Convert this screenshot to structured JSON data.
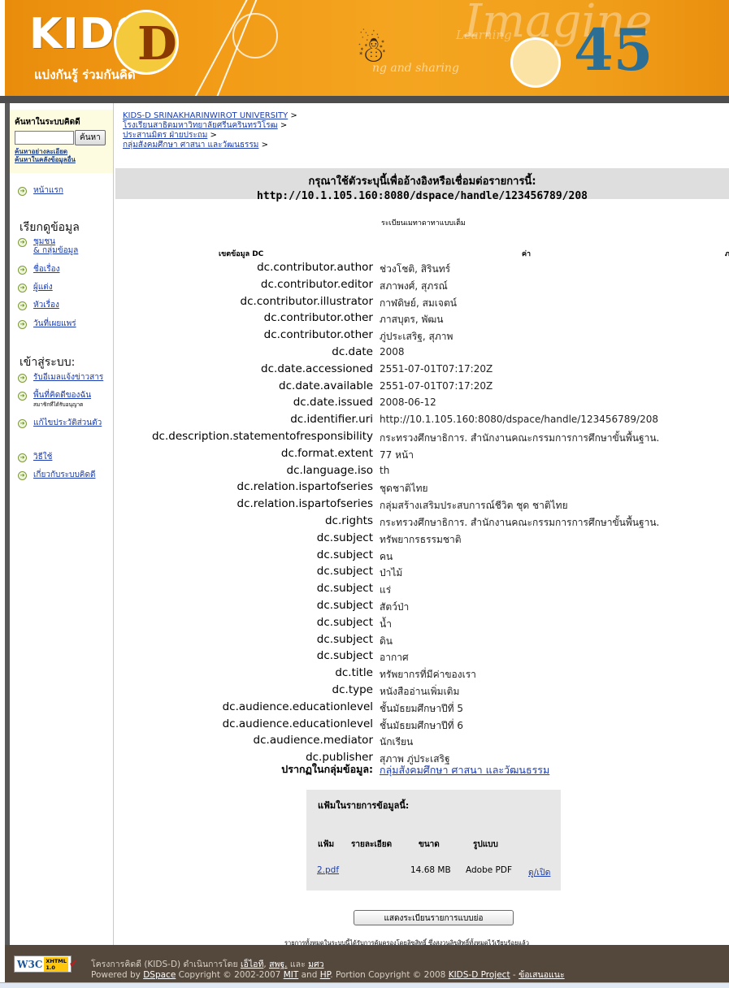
{
  "banner": {
    "logo_text": "KIDS",
    "logo_letter": "D",
    "tagline": "แบ่งกันรู้ ร่วมกันคิด",
    "faint_text_1": "Imagine",
    "faint_text_2": "Learning",
    "faint_text_3": "ng and sharing",
    "numbers": "45"
  },
  "sidebar": {
    "search_title": "ค้นหาในระบบคิดดี",
    "search_button": "ค้นหา",
    "search_value": "",
    "advanced_search": "ค้นหาอย่างละเอียด",
    "other_search": "ค้นหาในคลังข้อมูลอื่น",
    "home": "หน้าแรก",
    "browse_heading": "เรียกดูข้อมูล",
    "browse_communities_1": "ชุมชน",
    "browse_communities_2": "& กลุ่มข้อมูล",
    "browse_title": "ชื่อเรื่อง",
    "browse_author": "ผู้แต่ง",
    "browse_subject": "หัวเรื่อง",
    "browse_date": "วันที่เผยแพร่",
    "login_heading": "เข้าสู่ระบบ:",
    "alerts": "รับอีเมลแจ้งข่าวสาร",
    "my_space": "พื้นที่คิดดีของฉัน",
    "my_space_note": "สมาชิกที่ได้รับอนุญาต",
    "edit_profile": "แก้ไขประวัติส่วนตัว",
    "help": "วิธีใช้",
    "about": "เกี่ยวกับระบบคิดดี"
  },
  "breadcrumb": {
    "b1": "KIDS-D SRINAKHARINWIROT UNIVERSITY",
    "b2": "โรงเรียนสาธิตมหาวิทยาลัยศรีนครินทรวิโรฒ",
    "b3": "ประสานมิตร ฝ่ายประถม",
    "b4": "กลุ่มสังคมศึกษา ศาสนา และวัฒนธรรม",
    "sep": ">"
  },
  "citation": {
    "label": "กรุณาใช้ตัวระบุนี้เพื่ออ้างอิงหรือเชื่อมต่อรายการนี้:",
    "url": "http://10.1.105.160:8080/dspace/handle/123456789/208"
  },
  "record": {
    "full_record_label": "ระเบียนเมทาดาทาแบบเต็ม",
    "col_field": "เขตข้อมูล DC",
    "col_value": "ค่า",
    "col_lang": "ภ",
    "rows": [
      {
        "key": "dc.contributor.author",
        "value": "ช่วงโชติ, สิรินทร์"
      },
      {
        "key": "dc.contributor.editor",
        "value": "สภาพงศ์, สุภรณ์"
      },
      {
        "key": "dc.contributor.illustrator",
        "value": "กาฬดิษย์, สมเจตน์"
      },
      {
        "key": "dc.contributor.other",
        "value": "ภาสบุตร, พัฒน"
      },
      {
        "key": "dc.contributor.other",
        "value": "ภู่ประเสริฐ, สุภาพ"
      },
      {
        "key": "dc.date",
        "value": "2008"
      },
      {
        "key": "dc.date.accessioned",
        "value": "2551-07-01T07:17:20Z"
      },
      {
        "key": "dc.date.available",
        "value": "2551-07-01T07:17:20Z"
      },
      {
        "key": "dc.date.issued",
        "value": "2008-06-12"
      },
      {
        "key": "dc.identifier.uri",
        "value": "http://10.1.105.160:8080/dspace/handle/123456789/208"
      },
      {
        "key": "dc.description.statementofresponsibility",
        "value": "กระทรวงศึกษาธิการ. สำนักงานคณะกรรมการการศึกษาขั้นพื้นฐาน."
      },
      {
        "key": "dc.format.extent",
        "value": "77 หน้า"
      },
      {
        "key": "dc.language.iso",
        "value": "th"
      },
      {
        "key": "dc.relation.ispartofseries",
        "value": "ชุดชาติไทย"
      },
      {
        "key": "dc.relation.ispartofseries",
        "value": "กลุ่มสร้างเสริมประสบการณ์ชีวิต ชุด ชาติไทย"
      },
      {
        "key": "dc.rights",
        "value": "กระทรวงศึกษาธิการ. สำนักงานคณะกรรมการการศึกษาขั้นพื้นฐาน."
      },
      {
        "key": "dc.subject",
        "value": "ทรัพยากรธรรมชาติ"
      },
      {
        "key": "dc.subject",
        "value": "คน"
      },
      {
        "key": "dc.subject",
        "value": "ป่าไม้"
      },
      {
        "key": "dc.subject",
        "value": "แร่"
      },
      {
        "key": "dc.subject",
        "value": "สัตว์ป่า"
      },
      {
        "key": "dc.subject",
        "value": "น้ำ"
      },
      {
        "key": "dc.subject",
        "value": "ดิน"
      },
      {
        "key": "dc.subject",
        "value": "อากาศ"
      },
      {
        "key": "dc.title",
        "value": "ทรัพยากรที่มีค่าของเรา"
      },
      {
        "key": "dc.type",
        "value": "หนังสืออ่านเพิ่มเติม"
      },
      {
        "key": "dc.audience.educationlevel",
        "value": "ชั้นมัธยมศึกษาปีที่ 5"
      },
      {
        "key": "dc.audience.educationlevel",
        "value": "ชั้นมัธยมศึกษาปีที่ 6"
      },
      {
        "key": "dc.audience.mediator",
        "value": "นักเรียน"
      },
      {
        "key": "dc.publisher",
        "value": "สุภาพ ภู่ประเสริฐ"
      }
    ],
    "collection_label": "ปรากฏในกลุ่มข้อมูล:",
    "collection_link": "กลุ่มสังคมศึกษา ศาสนา และวัฒนธรรม"
  },
  "files": {
    "title": "แฟ้มในรายการข้อมูลนี้:",
    "h_file": "แฟ้ม",
    "h_desc": "รายละเอียด",
    "h_size": "ขนาด",
    "h_format": "รูปแบบ",
    "file_name": "2.pdf",
    "file_size": "14.68 MB",
    "file_format": "Adobe PDF",
    "file_view": "ดู/เปิด"
  },
  "show_simple_button": "แสดงระเบียนรายการแบบย่อ",
  "rights_note": "รายการทั้งหมดในระบบนี้ได้รับการคุ้มครองโดยลิขสิทธิ์ ซึ่งสงวนลิขสิทธิ์ทั้งหมดไว้เรียบร้อยแล้ว",
  "footer": {
    "w3c": "W3C",
    "xhtml": "XHTML 1.0",
    "l1_text": "โครงการคิดดี (KIDS-D) ดำเนินการโดย",
    "l1_link1": "เอ็ไอที",
    "l1_comma": ",",
    "l1_link2": "สพฐ.",
    "l1_and": "และ",
    "l1_link3": "มศว",
    "l2_a": "Powered by",
    "l2_dspace": "DSpace",
    "l2_b": "Copyright © 2002-2007",
    "l2_mit": "MIT",
    "l2_and": "and",
    "l2_hp": "HP",
    "l2_c": ". Portion Copyright © 2008",
    "l2_kids": "KIDS-D Project",
    "l2_dash": "-",
    "l2_feedback": "ข้อเสนอแนะ"
  },
  "colors": {
    "banner_orange": "#f19a16",
    "footer_brown": "#54473c",
    "link_blue": "#1a3cb0",
    "cite_gray": "#dedede"
  }
}
